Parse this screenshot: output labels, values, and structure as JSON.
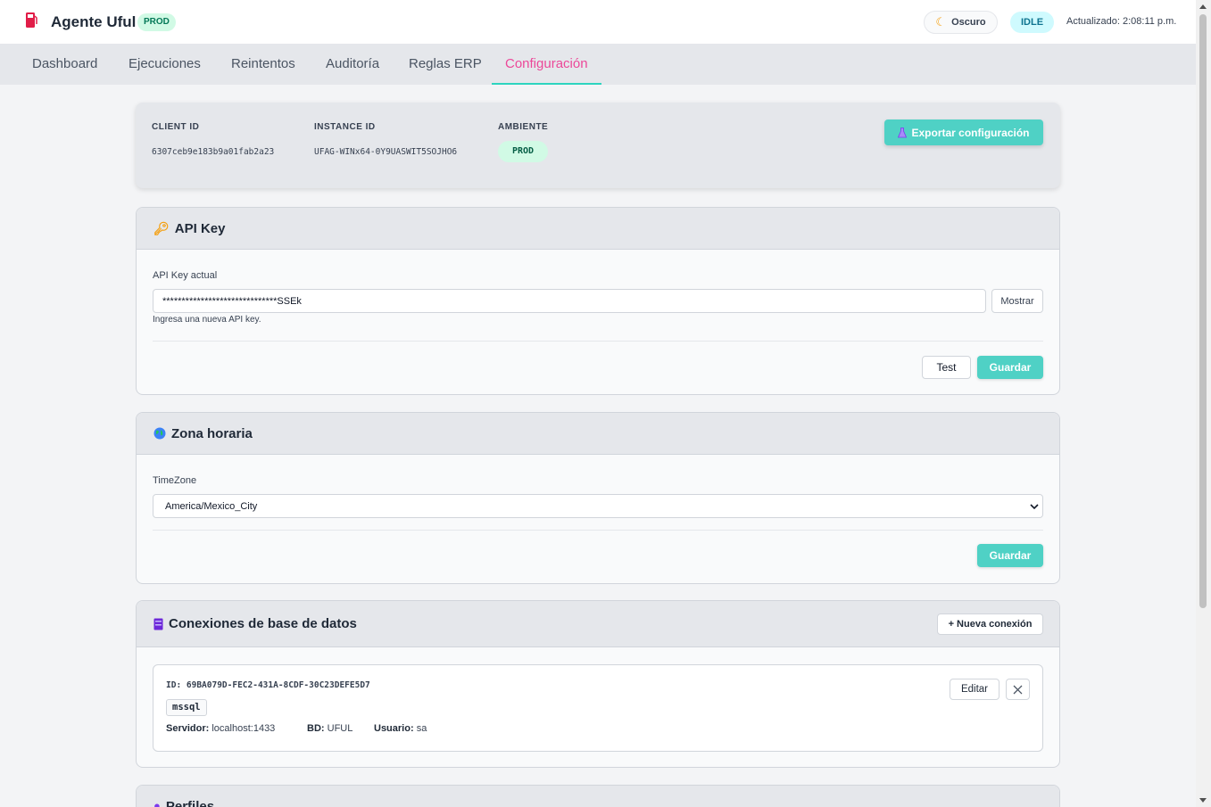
{
  "header": {
    "title": "Agente Uful",
    "env_badge": "PROD",
    "theme_toggle": "Oscuro",
    "status": "IDLE",
    "updated": "Actualizado: 2:08:11 p.m."
  },
  "nav": {
    "tabs": [
      {
        "label": "Dashboard"
      },
      {
        "label": "Ejecuciones"
      },
      {
        "label": "Reintentos"
      },
      {
        "label": "Auditoría"
      },
      {
        "label": "Reglas ERP"
      },
      {
        "label": "Configuración"
      }
    ],
    "active_index": 5
  },
  "info": {
    "client_id_label": "CLIENT ID",
    "client_id": "6307ceb9e183b9a01fab2a23",
    "instance_id_label": "INSTANCE ID",
    "instance_id": "UFAG-WINx64-0Y9UASWIT5SOJHO6",
    "environment_label": "AMBIENTE",
    "environment": "PROD",
    "export_button": "Exportar configuración"
  },
  "api_key": {
    "title": "API Key",
    "field_label": "API Key actual",
    "value": "******************************SSEk",
    "show_button": "Mostrar",
    "hint": "Ingresa una nueva API key.",
    "test_button": "Test",
    "save_button": "Guardar"
  },
  "timezone": {
    "title": "Zona horaria",
    "field_label": "TimeZone",
    "selected": "America/Mexico_City",
    "save_button": "Guardar"
  },
  "connections": {
    "title": "Conexiones de base de datos",
    "new_button": "+ Nueva conexión",
    "items": [
      {
        "id": "ID: 69BA079D-FEC2-431A-8CDF-30C23DEFE5D7",
        "type": "mssql",
        "server_label": "Servidor:",
        "server": "localhost:1433",
        "db_label": "BD:",
        "db": "UFUL",
        "user_label": "Usuario:",
        "user": "sa",
        "edit_button": "Editar"
      }
    ]
  },
  "profiles": {
    "title": "Perfiles"
  },
  "colors": {
    "accent": "#4fd1c5",
    "active_tab": "#ec4899",
    "prod_badge_bg": "#d1fae5"
  },
  "icons": {
    "brand": "fuel-pump-icon",
    "theme": "moon-icon",
    "export": "flask-icon",
    "api_key": "key-icon",
    "timezone": "globe-icon",
    "connections": "server-icon",
    "profiles": "user-icon",
    "delete": "close-icon",
    "select": "chevron-down-icon"
  }
}
